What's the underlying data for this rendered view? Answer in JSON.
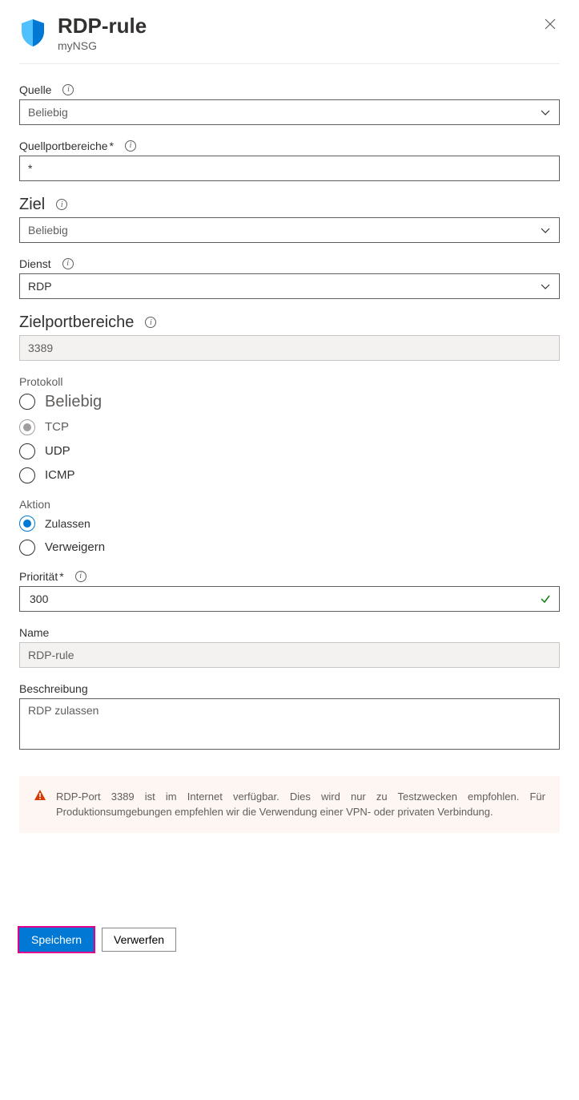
{
  "header": {
    "title": "RDP-rule",
    "subtitle": "myNSG"
  },
  "source": {
    "label": "Quelle",
    "value": "Beliebig"
  },
  "sourcePortRanges": {
    "label": "Quellportbereiche",
    "required": "*",
    "value": "*"
  },
  "destination": {
    "label": "Ziel",
    "value": "Beliebig"
  },
  "service": {
    "label": "Dienst",
    "value": "RDP"
  },
  "destPortRanges": {
    "label": "Zielportbereiche",
    "value": "3389"
  },
  "protocol": {
    "label": "Protokoll",
    "options": {
      "any": "Beliebig",
      "tcp": "TCP",
      "udp": "UDP",
      "icmp": "ICMP"
    }
  },
  "action": {
    "label": "Aktion",
    "options": {
      "allow": "Zulassen",
      "deny": "Verweigern"
    }
  },
  "priority": {
    "label": "Priorität",
    "required": "*",
    "value": "300"
  },
  "name": {
    "label": "Name",
    "value": "RDP-rule"
  },
  "description": {
    "label": "Beschreibung",
    "value": "RDP zulassen"
  },
  "warning": {
    "text": "RDP-Port 3389 ist im Internet verfügbar. Dies wird nur zu Testzwecken empfohlen. Für Produktionsumgebungen empfehlen wir die Verwendung einer VPN- oder privaten Verbindung."
  },
  "footer": {
    "save": "Speichern",
    "discard": "Verwerfen"
  }
}
